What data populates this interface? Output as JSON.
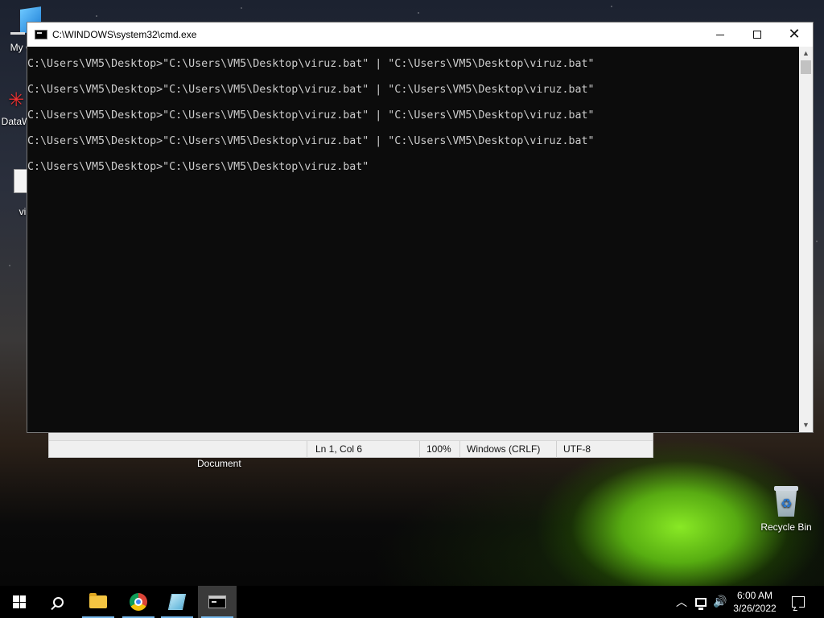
{
  "desktop": {
    "icons": [
      {
        "label": "My Co"
      },
      {
        "label": "DataW"
      },
      {
        "label": "vi"
      },
      {
        "label": "Recycle Bin"
      }
    ]
  },
  "notepad": {
    "status": {
      "position": "Ln 1, Col 6",
      "zoom": "100%",
      "line_endings": "Windows (CRLF)",
      "encoding": "UTF-8"
    },
    "doc_label": "Document"
  },
  "cmd": {
    "title": "C:\\WINDOWS\\system32\\cmd.exe",
    "lines": [
      "C:\\Users\\VM5\\Desktop>\"C:\\Users\\VM5\\Desktop\\viruz.bat\" | \"C:\\Users\\VM5\\Desktop\\viruz.bat\"",
      "C:\\Users\\VM5\\Desktop>\"C:\\Users\\VM5\\Desktop\\viruz.bat\" | \"C:\\Users\\VM5\\Desktop\\viruz.bat\"",
      "C:\\Users\\VM5\\Desktop>\"C:\\Users\\VM5\\Desktop\\viruz.bat\" | \"C:\\Users\\VM5\\Desktop\\viruz.bat\"",
      "C:\\Users\\VM5\\Desktop>\"C:\\Users\\VM5\\Desktop\\viruz.bat\" | \"C:\\Users\\VM5\\Desktop\\viruz.bat\"",
      "C:\\Users\\VM5\\Desktop>\"C:\\Users\\VM5\\Desktop\\viruz.bat\""
    ]
  },
  "taskbar": {
    "apps": [
      "start-icon",
      "search-icon",
      "file-explorer-icon",
      "chrome-icon",
      "notepad-icon",
      "cmd-icon"
    ],
    "clock": {
      "time": "6:00 AM",
      "date": "3/26/2022"
    }
  },
  "colors": {
    "console_bg": "#0c0c0c",
    "console_fg": "#cccccc",
    "taskbar_bg": "#000000",
    "active_accent": "#76b9ed"
  }
}
